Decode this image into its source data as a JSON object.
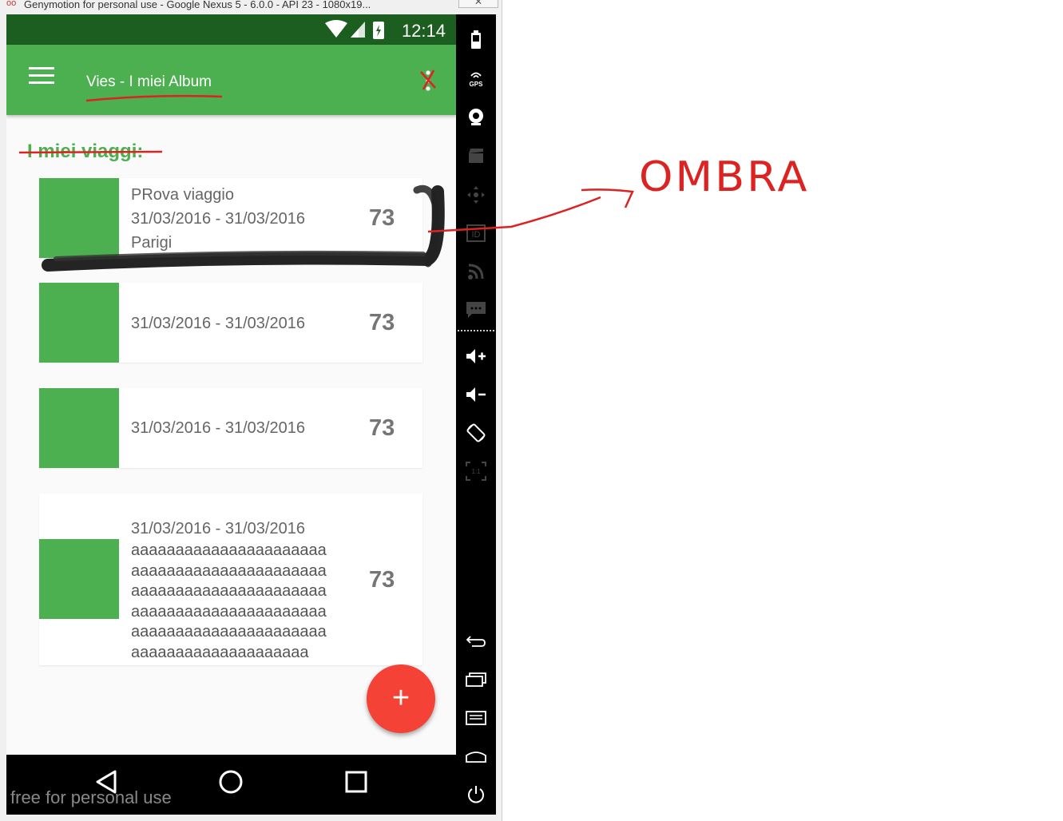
{
  "window": {
    "title": "Genymotion for personal use - Google Nexus 5 - 6.0.0 - API 23 - 1080x19...",
    "close_label": "✕"
  },
  "status_bar": {
    "time": "12:14"
  },
  "app_bar": {
    "title": "Vies - I miei Album"
  },
  "section_title": "I miei viaggi:",
  "trips": [
    {
      "name": "PRova viaggio",
      "dates": "31/03/2016 - 31/03/2016",
      "place": "Parigi",
      "count": "73"
    },
    {
      "name": "",
      "dates": "31/03/2016 - 31/03/2016",
      "place": "",
      "count": "73"
    },
    {
      "name": "",
      "dates": "31/03/2016 - 31/03/2016",
      "place": "",
      "count": "73"
    },
    {
      "name": "",
      "dates": "31/03/2016 - 31/03/2016",
      "description": [
        "aaaaaaaaaaaaaaaaaaaaaa",
        "aaaaaaaaaaaaaaaaaaaaaa",
        "aaaaaaaaaaaaaaaaaaaaaa",
        "aaaaaaaaaaaaaaaaaaaaaa",
        "aaaaaaaaaaaaaaaaaaaaaa",
        "aaaaaaaaaaaaaaaaaaaa"
      ],
      "count": "73"
    }
  ],
  "fab": {
    "label": "+"
  },
  "watermark": "free for personal use",
  "annotation": {
    "label": "OMBRA"
  },
  "colors": {
    "primary": "#4caf50",
    "primary_dark": "#1b5e20",
    "accent": "#f44336",
    "annotation": "#dd2222"
  },
  "sidebar_icons": [
    "battery-icon",
    "gps-icon",
    "camera-icon",
    "video-icon",
    "dpad-icon",
    "id-icon",
    "rss-icon",
    "sms-icon",
    "volume-up-icon",
    "volume-down-icon",
    "rotate-icon",
    "pixel-perfect-icon",
    "back-icon",
    "recent-apps-icon",
    "menu-icon",
    "home-icon",
    "power-icon"
  ]
}
